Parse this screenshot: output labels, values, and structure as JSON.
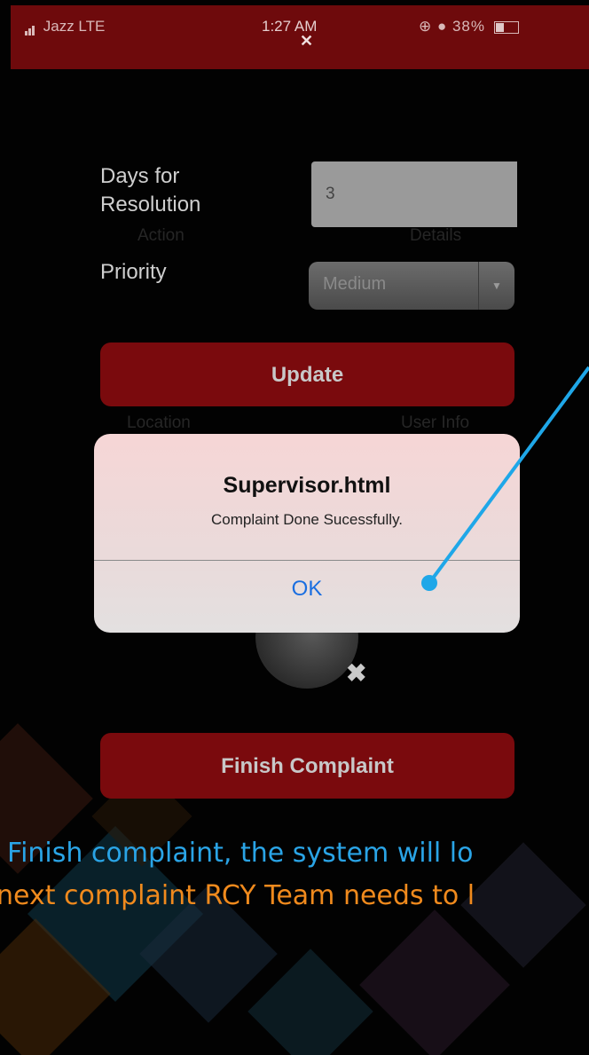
{
  "status_bar": {
    "carrier": "Jazz LTE",
    "time": "1:27 AM",
    "close_glyph": "✕",
    "right_icons": "⊕ ● 38%",
    "battery_percent": 38
  },
  "background_labels": {
    "action": "Action",
    "details": "Details",
    "location": "Location",
    "user_info": "User Info"
  },
  "form": {
    "days_label": "Days for Resolution",
    "days_value": "3",
    "priority_label": "Priority",
    "priority_value": "Medium",
    "update_label": "Update",
    "finish_label": "Finish Complaint"
  },
  "avatar": {
    "remove_glyph": "✖"
  },
  "dialog": {
    "title": "Supervisor.html",
    "message": "Complaint Done Sucessfully.",
    "ok_label": "OK"
  },
  "annotation": {
    "line1": "Finish complaint, the system will lo",
    "line2": "next complaint RCY Team needs to l",
    "line1_color": "#2aa4e6",
    "line2_color": "#f08a1d",
    "pointer_color": "#1fa7e8"
  },
  "colors": {
    "brand_red": "#7a0a0d",
    "dialog_button": "#1a6ee0"
  }
}
